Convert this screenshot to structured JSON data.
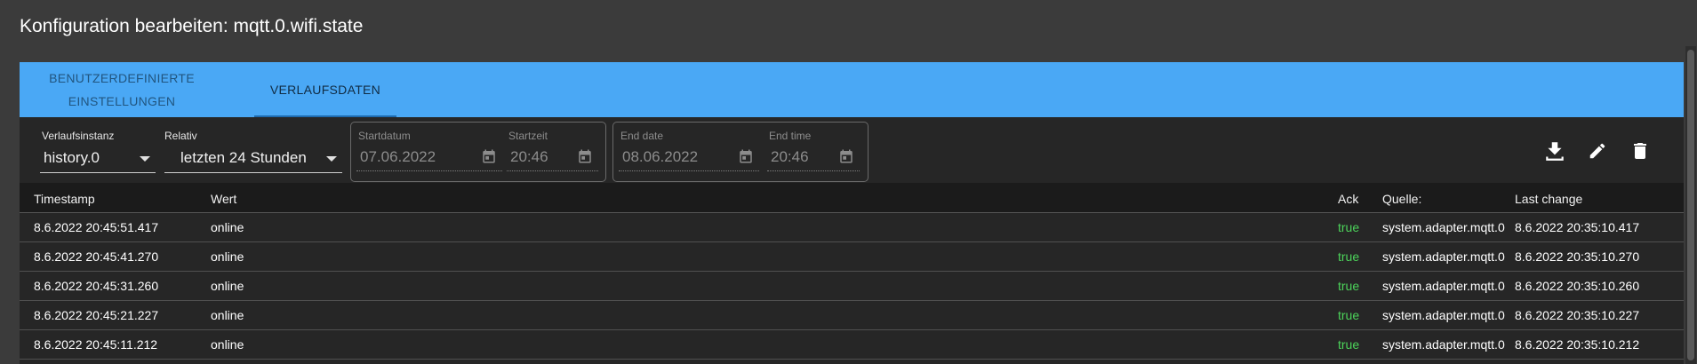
{
  "title": "Konfiguration bearbeiten: mqtt.0.wifi.state",
  "tabs": [
    {
      "label": "BENUTZERDEFINIERTE\nEINSTELLUNGEN"
    },
    {
      "label": "VERLAUFSDATEN"
    }
  ],
  "active_tab": "VERLAUFSDATEN",
  "filters": {
    "instance_label": "Verlaufsinstanz",
    "instance_value": "history.0",
    "relative_label": "Relativ",
    "relative_value": "letzten 24 Stunden",
    "start_date_label": "Startdatum",
    "start_date_value": "07.06.2022",
    "start_time_label": "Startzeit",
    "start_time_value": "20:46",
    "end_date_label": "End date",
    "end_date_value": "08.06.2022",
    "end_time_label": "End time",
    "end_time_value": "20:46"
  },
  "actions": [
    "download-icon",
    "edit-icon",
    "delete-icon"
  ],
  "table": {
    "headers": {
      "timestamp": "Timestamp",
      "value": "Wert",
      "ack": "Ack",
      "source": "Quelle:",
      "last_change": "Last change"
    },
    "rows": [
      {
        "timestamp": "8.6.2022 20:45:51.417",
        "value": "online",
        "ack": "true",
        "source": "system.adapter.mqtt.0",
        "last_change": "8.6.2022 20:35:10.417"
      },
      {
        "timestamp": "8.6.2022 20:45:41.270",
        "value": "online",
        "ack": "true",
        "source": "system.adapter.mqtt.0",
        "last_change": "8.6.2022 20:35:10.270"
      },
      {
        "timestamp": "8.6.2022 20:45:31.260",
        "value": "online",
        "ack": "true",
        "source": "system.adapter.mqtt.0",
        "last_change": "8.6.2022 20:35:10.260"
      },
      {
        "timestamp": "8.6.2022 20:45:21.227",
        "value": "online",
        "ack": "true",
        "source": "system.adapter.mqtt.0",
        "last_change": "8.6.2022 20:35:10.227"
      },
      {
        "timestamp": "8.6.2022 20:45:11.212",
        "value": "online",
        "ack": "true",
        "source": "system.adapter.mqtt.0",
        "last_change": "8.6.2022 20:35:10.212"
      }
    ]
  },
  "colors": {
    "tab_bar": "#4aa8f5",
    "ack_true": "#4cd35a",
    "background": "#262626"
  }
}
